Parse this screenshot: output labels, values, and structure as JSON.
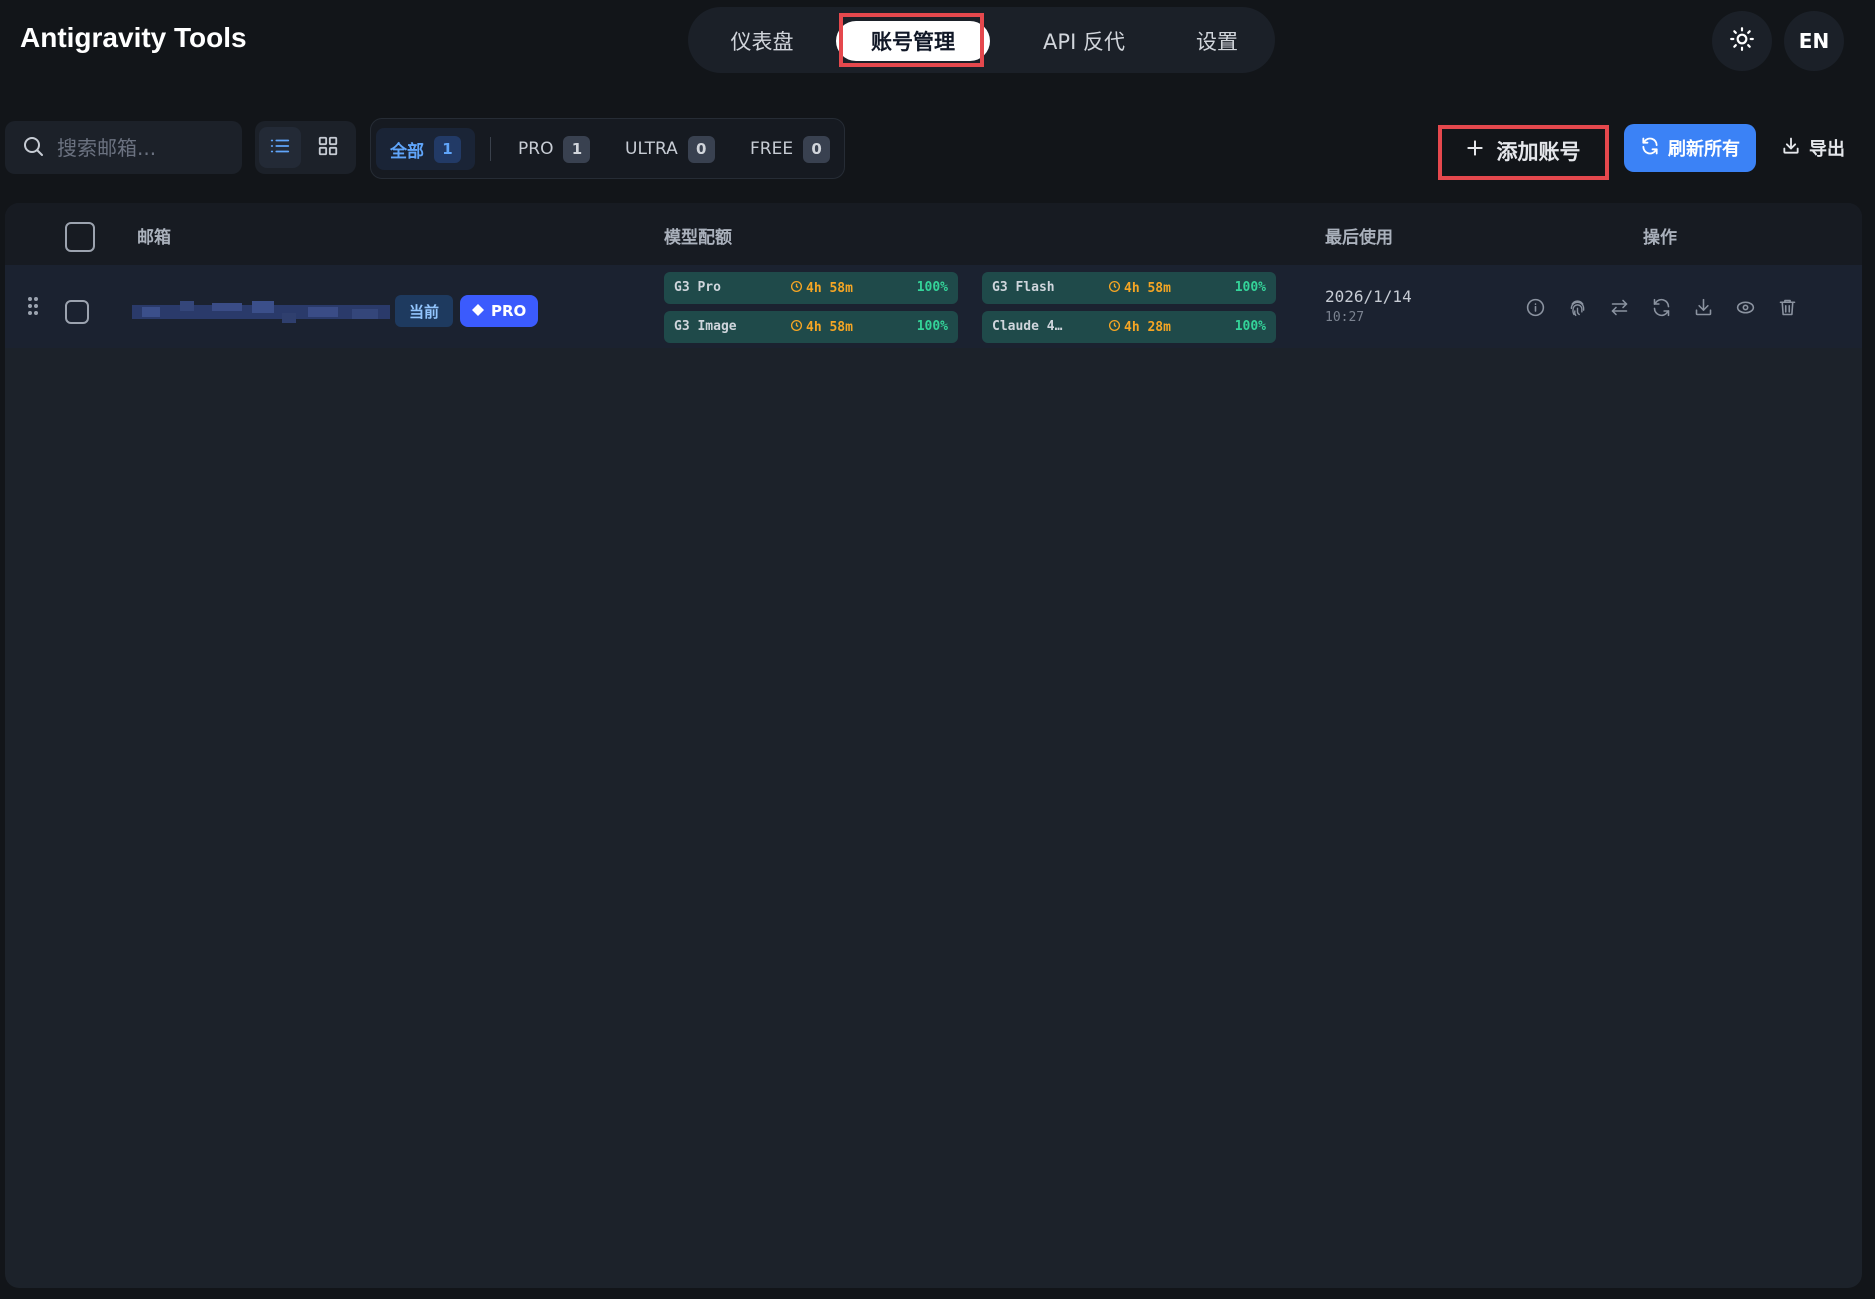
{
  "app": {
    "title": "Antigravity Tools"
  },
  "nav": {
    "tabs": [
      {
        "label": "仪表盘"
      },
      {
        "label": "账号管理",
        "active": true
      },
      {
        "label": "API 反代"
      },
      {
        "label": "设置"
      }
    ],
    "theme_icon": "sun-icon",
    "language": "EN"
  },
  "toolbar": {
    "search_placeholder": "搜索邮箱...",
    "view_modes": [
      "list-icon",
      "grid-icon"
    ],
    "filters": [
      {
        "label": "全部",
        "count": "1",
        "active": true
      },
      {
        "label": "PRO",
        "count": "1"
      },
      {
        "label": "ULTRA",
        "count": "0"
      },
      {
        "label": "FREE",
        "count": "0"
      }
    ],
    "add_label": "添加账号",
    "refresh_label": "刷新所有",
    "export_label": "导出"
  },
  "table": {
    "headers": {
      "email": "邮箱",
      "quota": "模型配额",
      "last_used": "最后使用",
      "actions": "操作"
    },
    "rows": [
      {
        "badge_current": "当前",
        "badge_tier": "PRO",
        "quotas": [
          {
            "name": "G3 Pro",
            "reset": "4h 58m",
            "percent": "100%"
          },
          {
            "name": "G3 Flash",
            "reset": "4h 58m",
            "percent": "100%"
          },
          {
            "name": "G3 Image",
            "reset": "4h 58m",
            "percent": "100%"
          },
          {
            "name": "Claude 4…",
            "reset": "4h 28m",
            "percent": "100%"
          }
        ],
        "last_used_date": "2026/1/14",
        "last_used_time": "10:27",
        "actions": [
          "info-icon",
          "fingerprint-icon",
          "switch-icon",
          "refresh-icon",
          "download-icon",
          "eye-icon",
          "trash-icon"
        ]
      }
    ]
  },
  "colors": {
    "background": "#121519",
    "accent": "#3b82f6",
    "highlight": "#e5484d",
    "quota_ok": "#34d399",
    "quota_time": "#f5a524"
  }
}
